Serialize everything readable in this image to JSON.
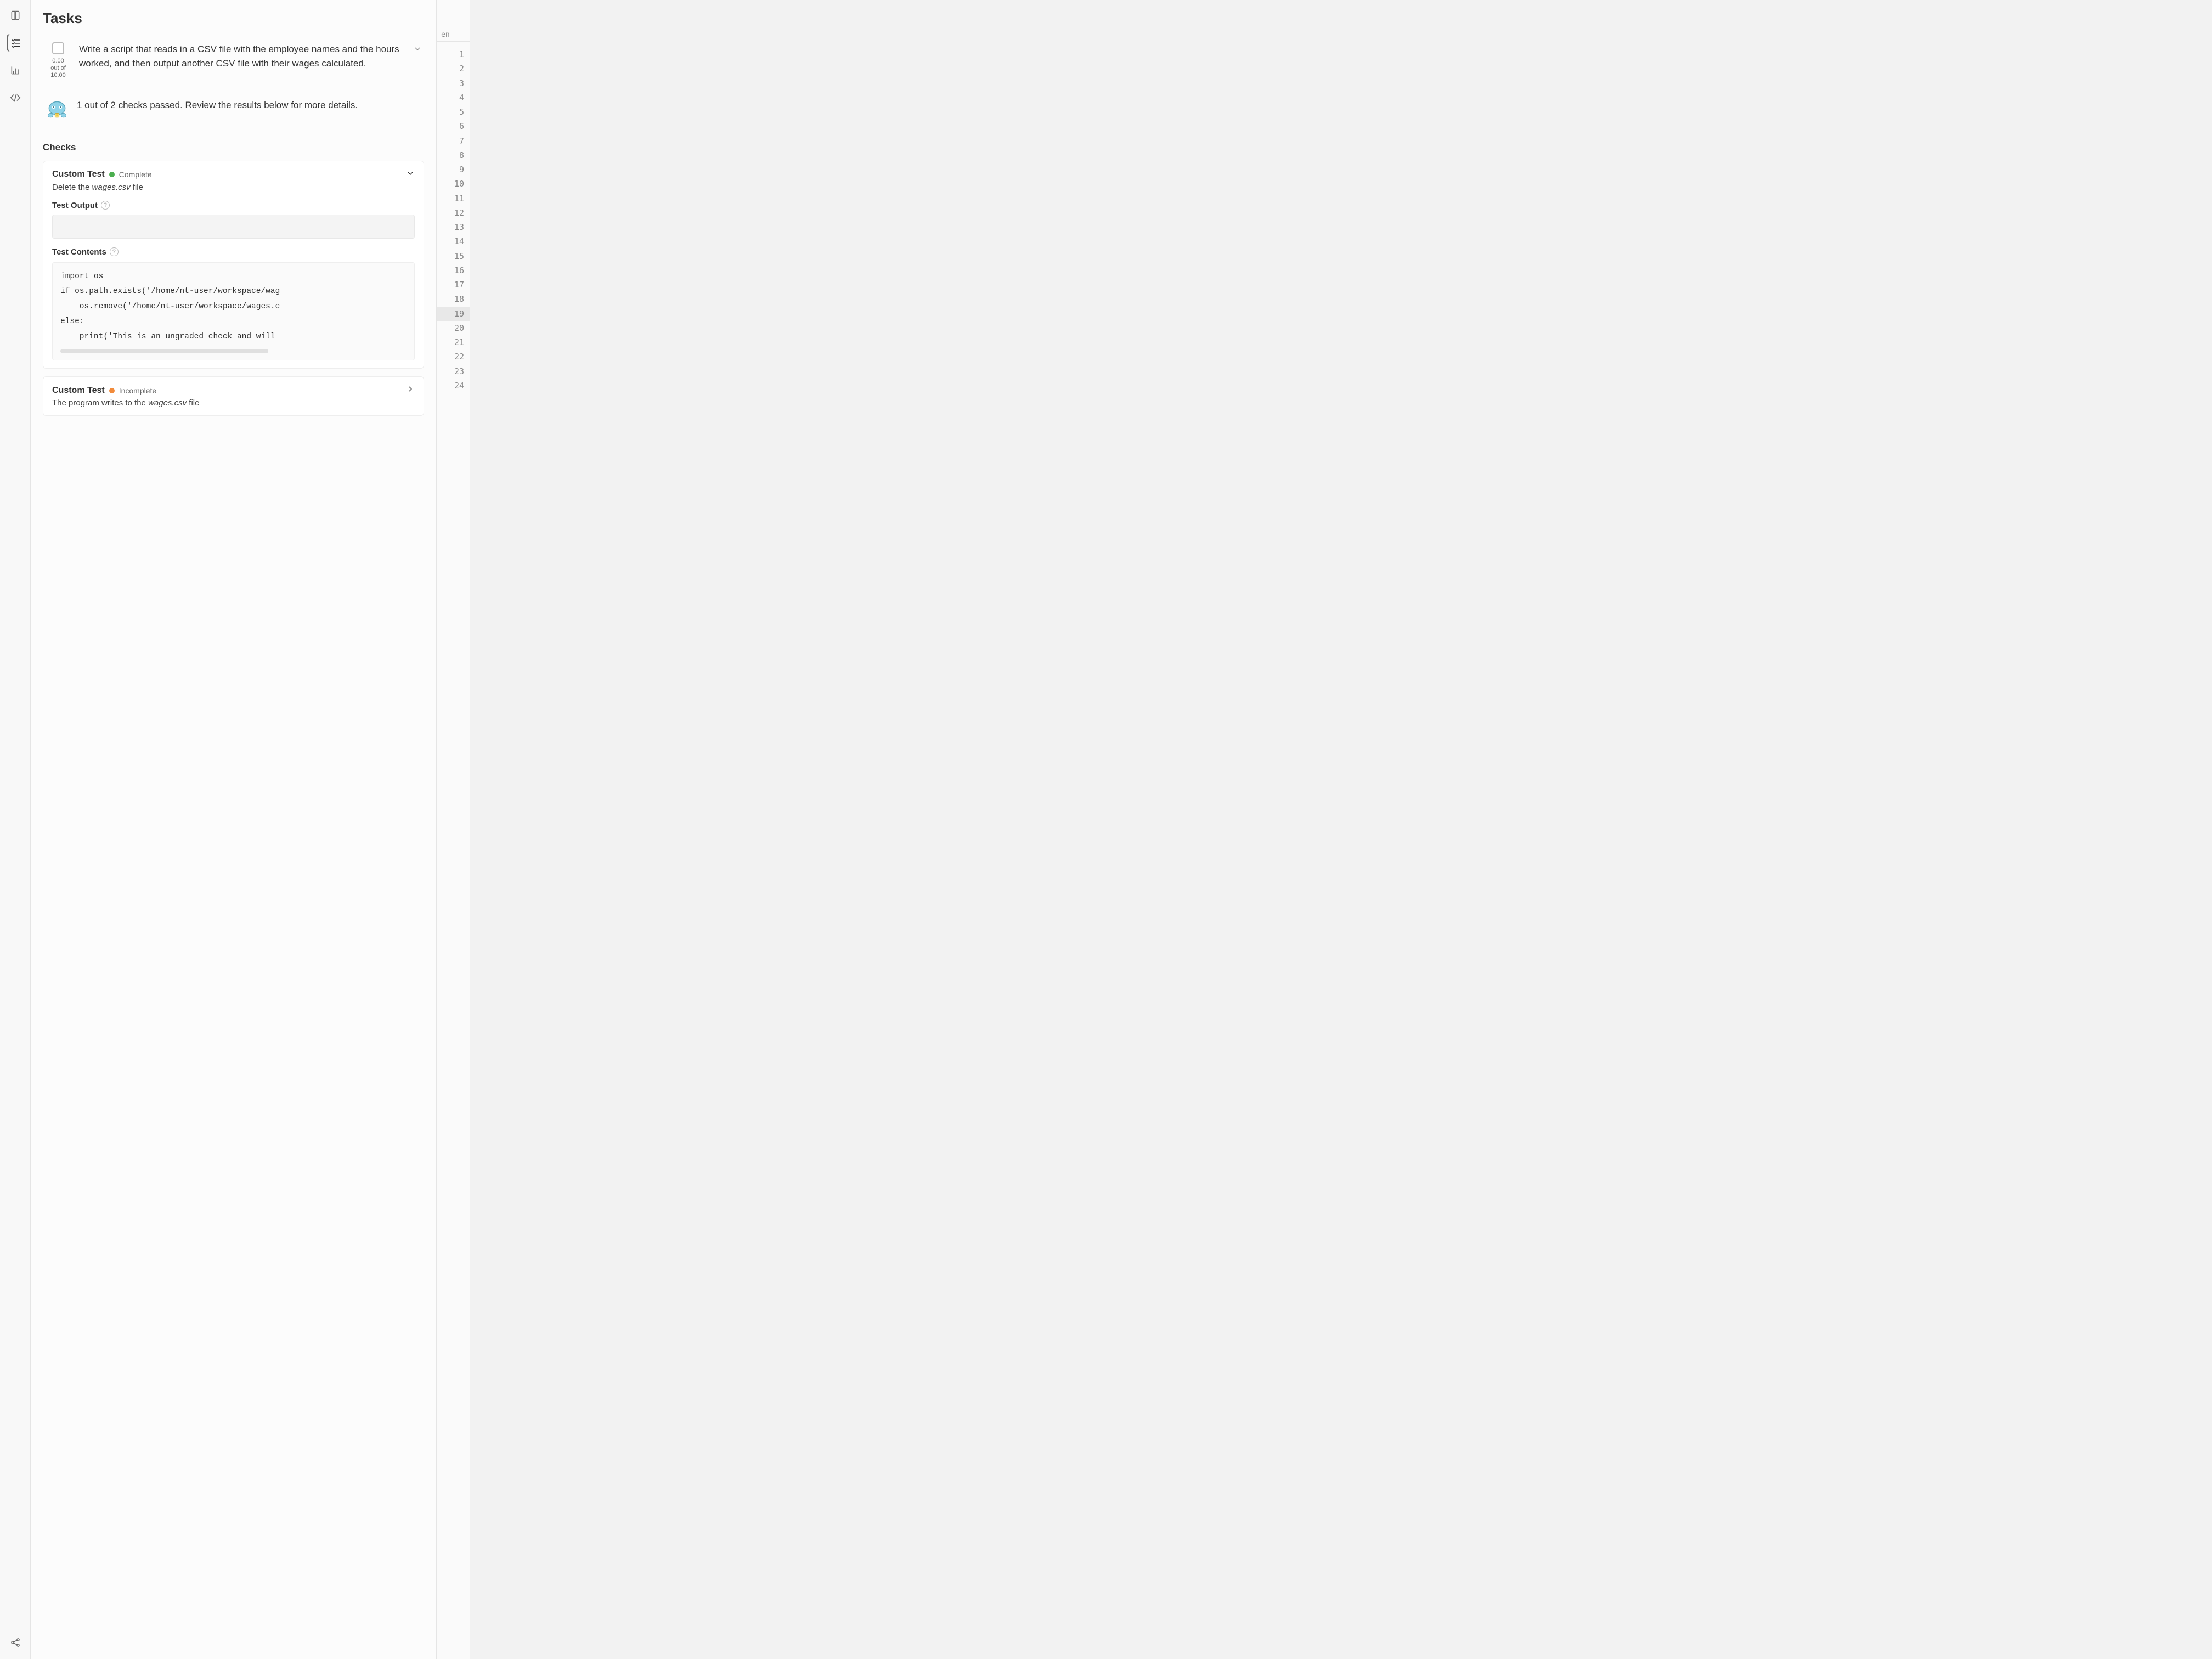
{
  "panel_title": "Tasks",
  "task": {
    "score_value": "0.00",
    "score_total_line1": "out of",
    "score_total_line2": "10.00",
    "description": "Write a script that reads in a CSV file with the employee names and the hours worked, and then output another CSV file with their wages calculated."
  },
  "result_message": "1 out of 2 checks passed. Review the results below for more details.",
  "checks_heading": "Checks",
  "check1": {
    "title": "Custom Test",
    "status_label": "Complete",
    "subtitle_prefix": "Delete the ",
    "subtitle_filename": "wages.csv",
    "subtitle_suffix": " file",
    "test_output_label": "Test Output",
    "test_contents_label": "Test Contents",
    "code_lines": [
      "import os",
      "if os.path.exists('/home/nt-user/workspace/wag",
      "    os.remove('/home/nt-user/workspace/wages.c",
      "else:",
      "    print('This is an ungraded check and will"
    ]
  },
  "check2": {
    "title": "Custom Test",
    "status_label": "Incomplete",
    "subtitle_prefix": "The program writes to the ",
    "subtitle_filename": "wages.csv",
    "subtitle_suffix": " file"
  },
  "editor": {
    "tab_label": "en",
    "lines": [
      "1",
      "2",
      "3",
      "4",
      "5",
      "6",
      "7",
      "8",
      "9",
      "10",
      "11",
      "12",
      "13",
      "14",
      "15",
      "16",
      "17",
      "18",
      "19",
      "20",
      "21",
      "22",
      "23",
      "24"
    ]
  }
}
